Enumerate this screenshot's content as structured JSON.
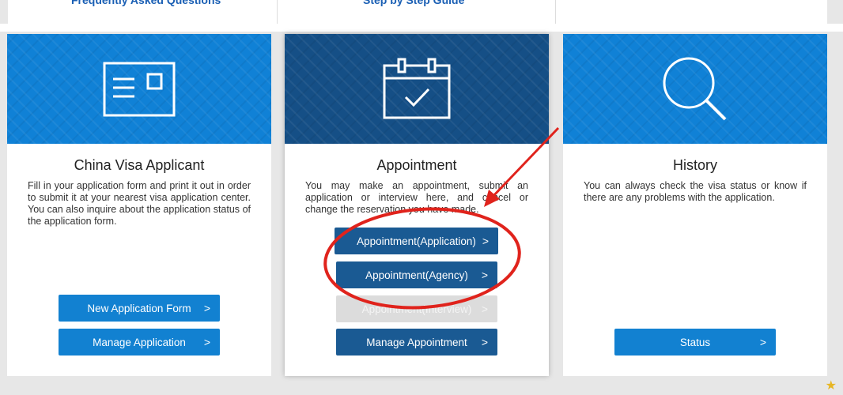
{
  "topnav": {
    "faq": "Frequently Asked Questions",
    "guide": "Step by Step Guide"
  },
  "cards": {
    "visa": {
      "title": "China Visa Applicant",
      "desc": "Fill in your application form and print it out in order to submit it at your nearest visa application center. You can also inquire about the application status of the application form.",
      "btn1": "New Application Form",
      "btn2": "Manage Application",
      "icon": "id-card-icon"
    },
    "appointment": {
      "title": "Appointment",
      "desc": "You may make an appointment, submit an application or interview here, and cancel or change the reservation you have made.",
      "btn1": "Appointment(Application)",
      "btn2": "Appointment(Agency)",
      "btn3": "Appointment(Interview)",
      "btn4": "Manage Appointment",
      "icon": "calendar-check-icon"
    },
    "history": {
      "title": "History",
      "desc": "You can always check the visa status or know if there are any problems with the application.",
      "btn1": "Status",
      "icon": "search-icon"
    }
  },
  "chevron": ">",
  "colors": {
    "hero_blue": "#1081d6",
    "hero_dark": "#154f86",
    "button_blue": "#1281d1",
    "button_dark": "#1a5a93",
    "annotation_red": "#e0231c"
  }
}
